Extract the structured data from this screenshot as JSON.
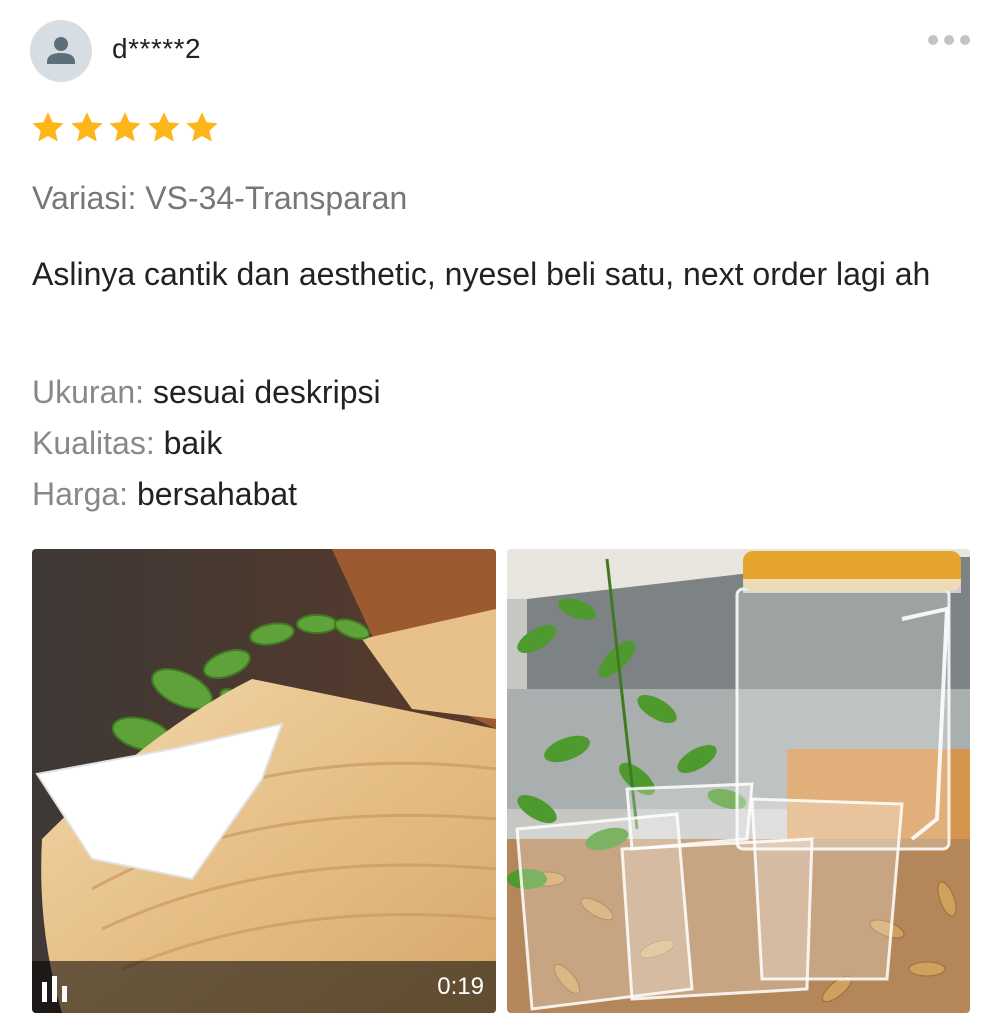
{
  "reviewer": {
    "username": "d*****2",
    "avatar_icon": "user-icon"
  },
  "menu_icon": "more-dots-icon",
  "rating": {
    "stars": 5,
    "max": 5,
    "color": "#fdb51a"
  },
  "variant": "Variasi: VS-34-Transparan",
  "review_text": "Aslinya cantik dan aesthetic, nyesel beli satu, next order lagi ah",
  "attributes": [
    {
      "label": "Ukuran:",
      "value": "sesuai deskripsi"
    },
    {
      "label": "Kualitas:",
      "value": "baik"
    },
    {
      "label": "Harga:",
      "value": "bersahabat"
    }
  ],
  "media": [
    {
      "type": "video",
      "duration": "0:19",
      "indicator_icon": "video-bars-icon"
    },
    {
      "type": "image"
    }
  ]
}
